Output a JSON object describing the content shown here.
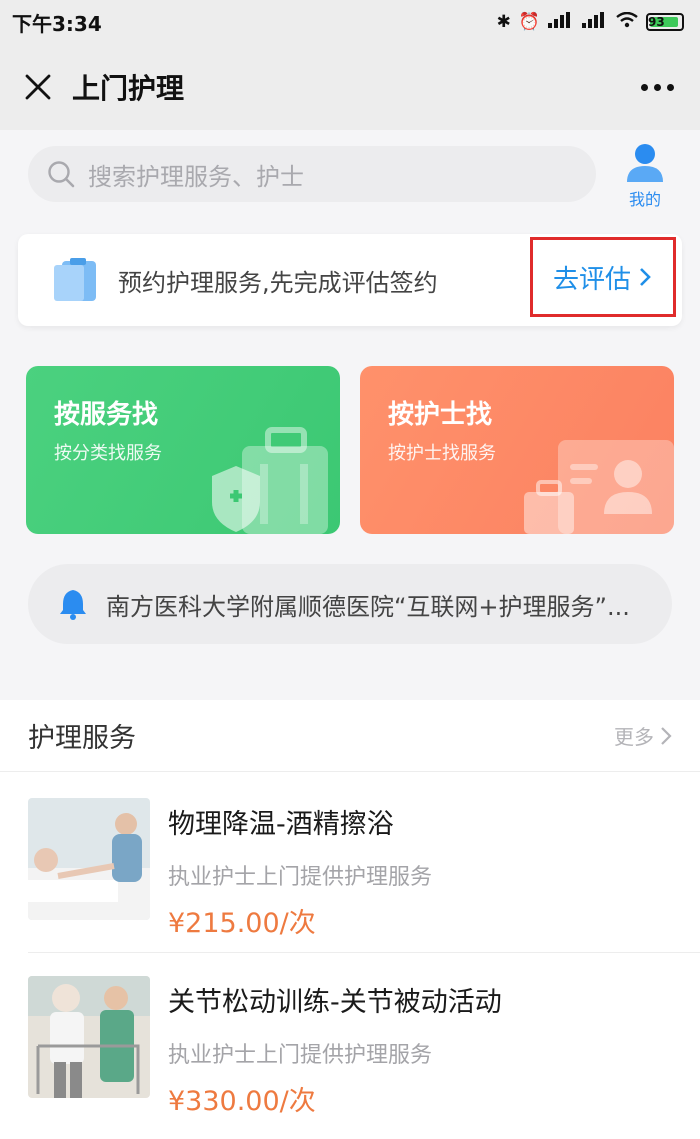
{
  "status_bar": {
    "time": "下午3:34",
    "battery": "93"
  },
  "nav": {
    "title": "上门护理"
  },
  "search": {
    "placeholder": "搜索护理服务、护士"
  },
  "mine": {
    "label": "我的"
  },
  "notice": {
    "text": "预约护理服务,先完成评估签约",
    "action_label": "去评估"
  },
  "tiles": [
    {
      "title": "按服务找",
      "subtitle": "按分类找服务"
    },
    {
      "title": "按护士找",
      "subtitle": "按护士找服务"
    }
  ],
  "announcement": {
    "text": "南方医科大学附属顺德医院“互联网+护理服务”..."
  },
  "services_section": {
    "title": "护理服务",
    "more_label": "更多",
    "items": [
      {
        "name": "物理降温-酒精擦浴",
        "desc": "执业护士上门提供护理服务",
        "price": "¥215.00/次"
      },
      {
        "name": "关节松动训练-关节被动活动",
        "desc": "执业护士上门提供护理服务",
        "price": "¥330.00/次"
      }
    ]
  },
  "colors": {
    "accent_blue": "#1f8fe8",
    "green_tile": "#3cc873",
    "orange_tile": "#fb8161",
    "price_orange": "#ee7a40",
    "highlight_red": "#e02b2b"
  }
}
